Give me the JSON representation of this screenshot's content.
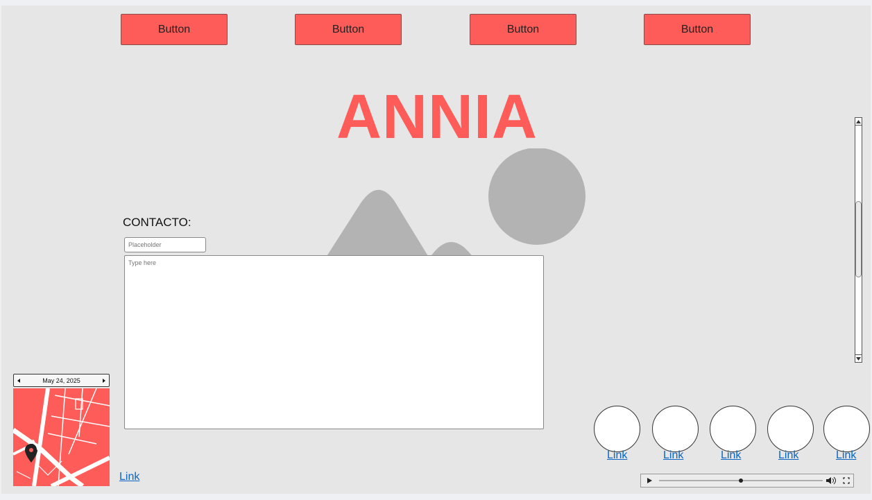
{
  "nav": {
    "buttons": [
      "Button",
      "Button",
      "Button",
      "Button"
    ]
  },
  "hero": {
    "title": "ANNIA"
  },
  "contact": {
    "label": "CONTACTO:",
    "input_placeholder": "Placeholder",
    "textarea_placeholder": "Type here"
  },
  "datepicker": {
    "date": "May 24, 2025"
  },
  "links": {
    "bottom_left": "Link",
    "avatars": [
      "Link",
      "Link",
      "Link",
      "Link",
      "Link"
    ]
  },
  "colors": {
    "accent": "#fe5c59",
    "canvas": "#e6e6e6",
    "placeholder_gray": "#b3b3b3",
    "link": "#0a66c2"
  },
  "media_player": {
    "progress": 0.5
  }
}
